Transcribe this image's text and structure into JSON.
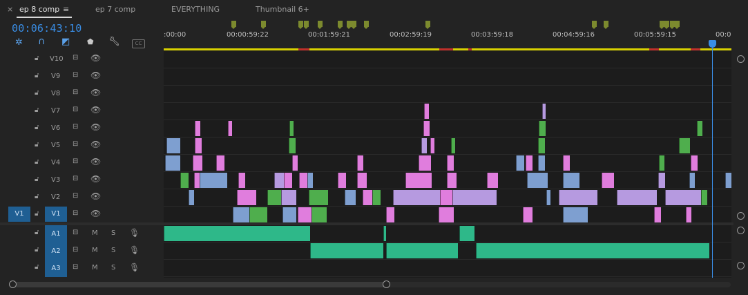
{
  "tabs": [
    {
      "label": "ep 8 comp",
      "active": true
    },
    {
      "label": "ep 7 comp"
    },
    {
      "label": "EVERYTHING"
    },
    {
      "label": "Thumbnail 6+"
    }
  ],
  "close_glyph": "×",
  "menu_glyph": "≡",
  "timecode": "00:06:43:10",
  "toolbar_icons": [
    "snap-icon",
    "linked-selection-icon",
    "insert-icon",
    "marker-icon",
    "wrench-icon",
    "captions-icon"
  ],
  "toolbar_cc": "CC",
  "ruler": {
    "labels": [
      ":00:00",
      "00:00:59:22",
      "00:01:59:21",
      "00:02:59:19",
      "00:03:59:18",
      "00:04:59:16",
      "00:05:59:15",
      "00:0"
    ]
  },
  "video_tracks": [
    "V10",
    "V9",
    "V8",
    "V7",
    "V6",
    "V5",
    "V4",
    "V3",
    "V2",
    "V1"
  ],
  "audio_tracks": [
    "A1",
    "A2",
    "A3"
  ],
  "source_patch": {
    "video": "V1"
  },
  "audio_controls": {
    "mute": "M",
    "solo": "S"
  },
  "colors": {
    "pink": "#e07ddd",
    "blue": "#7e9fd0",
    "green": "#4fae4d",
    "lavender": "#b69ae0",
    "audio": "#2eb889",
    "playhead": "#3a8ee6",
    "marker": "#7c8a2e"
  }
}
